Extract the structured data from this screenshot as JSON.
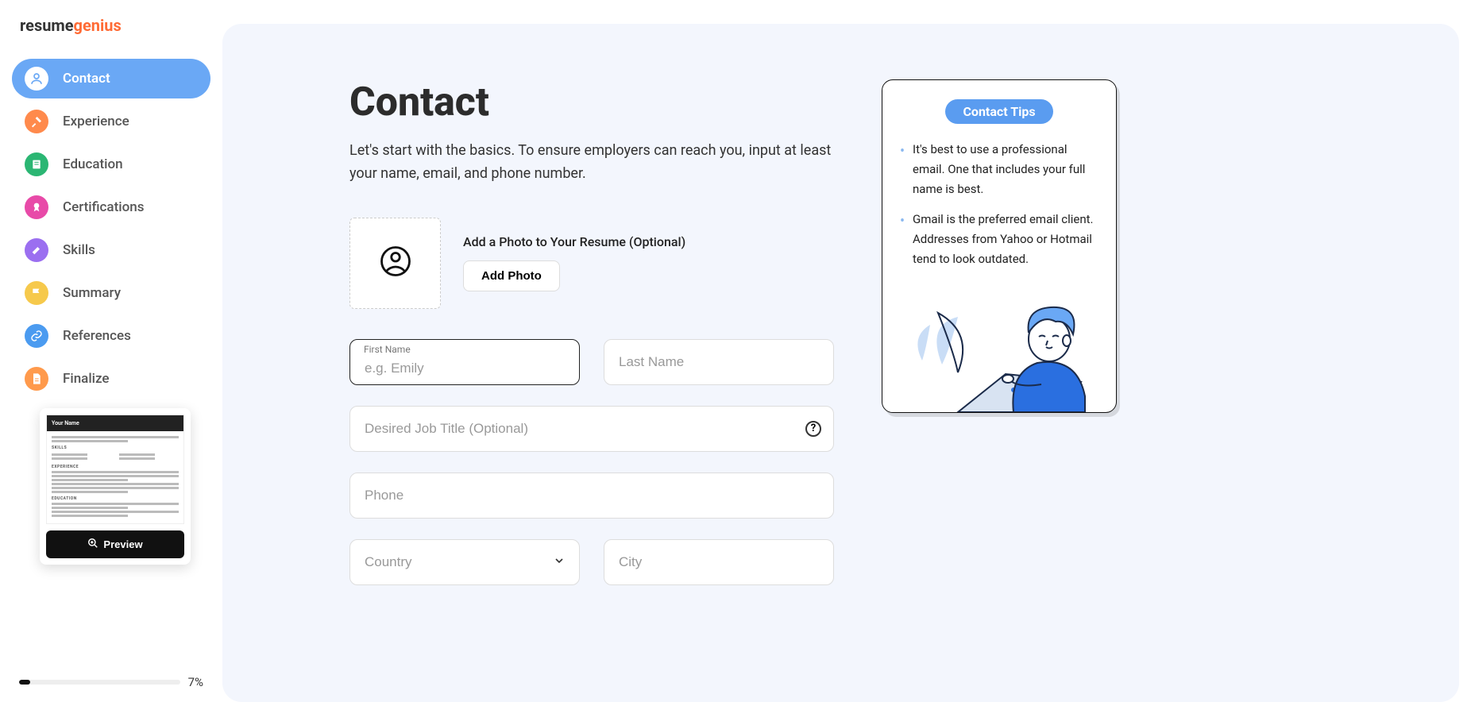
{
  "brand": {
    "part1": "resume",
    "part2": "genius"
  },
  "sidebar": {
    "items": [
      {
        "label": "Contact",
        "icon_bg": "#ffffff",
        "icon_fg": "#6aa8f5"
      },
      {
        "label": "Experience",
        "icon_bg": "#ff8a4c",
        "icon_fg": "#ffffff"
      },
      {
        "label": "Education",
        "icon_bg": "#2bb673",
        "icon_fg": "#ffffff"
      },
      {
        "label": "Certifications",
        "icon_bg": "#e84aa8",
        "icon_fg": "#ffffff"
      },
      {
        "label": "Skills",
        "icon_bg": "#9b6ff0",
        "icon_fg": "#ffffff"
      },
      {
        "label": "Summary",
        "icon_bg": "#f6c94c",
        "icon_fg": "#ffffff"
      },
      {
        "label": "References",
        "icon_bg": "#4b9bf0",
        "icon_fg": "#ffffff"
      },
      {
        "label": "Finalize",
        "icon_bg": "#ff9a4c",
        "icon_fg": "#ffffff"
      }
    ],
    "preview": {
      "doc_name": "Your Name",
      "skills_h": "SKILLS",
      "exp_h": "EXPERIENCE",
      "edu_h": "EDUCATION",
      "button": "Preview"
    },
    "progress_percent": 7,
    "progress_label": "7%"
  },
  "page": {
    "title": "Contact",
    "subtitle": "Let's start with the basics. To ensure employers can reach you, input at least your name, email, and phone number."
  },
  "photo": {
    "label": "Add a Photo to Your Resume (Optional)",
    "button": "Add Photo"
  },
  "fields": {
    "first_name_label": "First Name",
    "first_name_placeholder": "e.g. Emily",
    "first_name_value": "",
    "last_name_placeholder": "Last Name",
    "job_title_placeholder": "Desired Job Title (Optional)",
    "phone_placeholder": "Phone",
    "country_placeholder": "Country",
    "city_placeholder": "City"
  },
  "tips": {
    "badge": "Contact Tips",
    "items": [
      "It's best to use a professional email. One that includes your full name is best.",
      "Gmail is the preferred email client. Addresses from Yahoo or Hotmail tend to look outdated."
    ]
  }
}
